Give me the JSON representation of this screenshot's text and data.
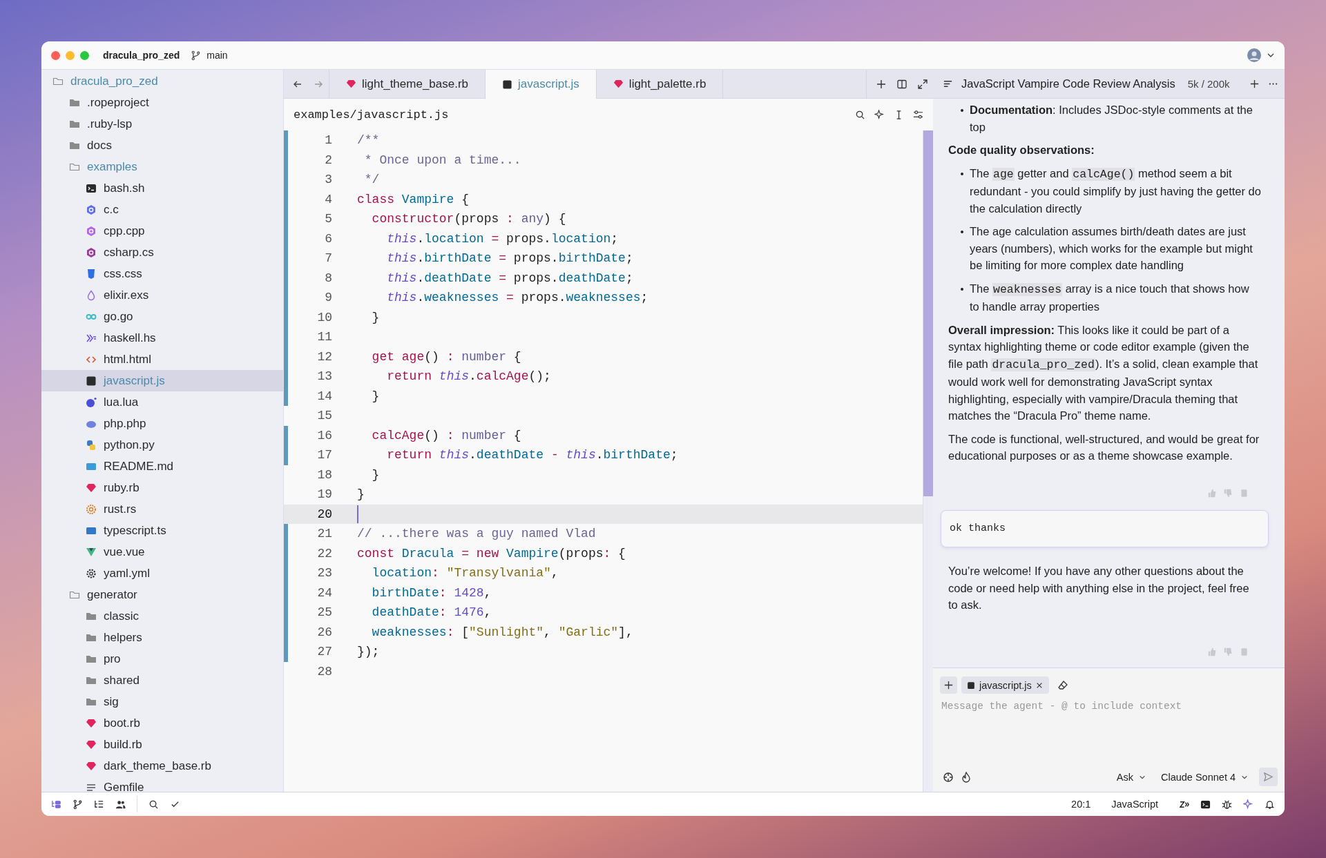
{
  "titlebar": {
    "project": "dracula_pro_zed",
    "branch": "main"
  },
  "sidebar": {
    "items": [
      {
        "name": "dracula_pro_zed",
        "kind": "folder",
        "expanded": true,
        "selected": false,
        "children": [
          {
            "name": ".ropeproject",
            "kind": "folder",
            "expanded": false,
            "selected": false
          },
          {
            "name": ".ruby-lsp",
            "kind": "folder",
            "expanded": false,
            "selected": false
          },
          {
            "name": "docs",
            "kind": "folder",
            "expanded": false,
            "selected": false
          },
          {
            "name": "examples",
            "kind": "folder",
            "expanded": true,
            "selected": false,
            "children": [
              {
                "name": "bash.sh",
                "kind": "shell",
                "selected": false
              },
              {
                "name": "c.c",
                "kind": "c",
                "selected": false
              },
              {
                "name": "cpp.cpp",
                "kind": "cpp",
                "selected": false
              },
              {
                "name": "csharp.cs",
                "kind": "csharp",
                "selected": false
              },
              {
                "name": "css.css",
                "kind": "css",
                "selected": false
              },
              {
                "name": "elixir.exs",
                "kind": "elixir",
                "selected": false
              },
              {
                "name": "go.go",
                "kind": "go",
                "selected": false
              },
              {
                "name": "haskell.hs",
                "kind": "haskell",
                "selected": false
              },
              {
                "name": "html.html",
                "kind": "html",
                "selected": false
              },
              {
                "name": "javascript.js",
                "kind": "js",
                "selected": true
              },
              {
                "name": "lua.lua",
                "kind": "lua",
                "selected": false
              },
              {
                "name": "php.php",
                "kind": "php",
                "selected": false
              },
              {
                "name": "python.py",
                "kind": "python",
                "selected": false
              },
              {
                "name": "README.md",
                "kind": "markdown",
                "selected": false
              },
              {
                "name": "ruby.rb",
                "kind": "ruby",
                "selected": false
              },
              {
                "name": "rust.rs",
                "kind": "rust",
                "selected": false
              },
              {
                "name": "typescript.ts",
                "kind": "ts",
                "selected": false
              },
              {
                "name": "vue.vue",
                "kind": "vue",
                "selected": false
              },
              {
                "name": "yaml.yml",
                "kind": "yaml",
                "selected": false
              }
            ]
          },
          {
            "name": "generator",
            "kind": "folder",
            "expanded": true,
            "selected": false,
            "children": [
              {
                "name": "classic",
                "kind": "folder",
                "expanded": false,
                "selected": false
              },
              {
                "name": "helpers",
                "kind": "folder",
                "expanded": false,
                "selected": false
              },
              {
                "name": "pro",
                "kind": "folder",
                "expanded": false,
                "selected": false
              },
              {
                "name": "shared",
                "kind": "folder",
                "expanded": false,
                "selected": false
              },
              {
                "name": "sig",
                "kind": "folder",
                "expanded": false,
                "selected": false
              },
              {
                "name": "boot.rb",
                "kind": "ruby",
                "selected": false
              },
              {
                "name": "build.rb",
                "kind": "ruby",
                "selected": false
              },
              {
                "name": "dark_theme_base.rb",
                "kind": "ruby",
                "selected": false
              },
              {
                "name": "Gemfile",
                "kind": "text",
                "selected": false
              }
            ]
          }
        ]
      }
    ]
  },
  "tabs": [
    {
      "label": "light_theme_base.rb",
      "kind": "ruby",
      "selected": false
    },
    {
      "label": "javascript.js",
      "kind": "js",
      "selected": true
    },
    {
      "label": "light_palette.rb",
      "kind": "ruby",
      "selected": false
    }
  ],
  "editor": {
    "path": "examples/javascript.js",
    "lines": [
      {
        "number": "1",
        "changed": true,
        "selected": false,
        "tokens": [
          {
            "kind": "cmt",
            "text": "/**"
          }
        ]
      },
      {
        "number": "2",
        "changed": true,
        "selected": false,
        "tokens": [
          {
            "kind": "cmt",
            "text": " * Once upon a time..."
          }
        ]
      },
      {
        "number": "3",
        "changed": true,
        "selected": false,
        "tokens": [
          {
            "kind": "cmt",
            "text": " */"
          }
        ]
      },
      {
        "number": "4",
        "changed": true,
        "selected": false,
        "tokens": [
          {
            "kind": "kw",
            "text": "class "
          },
          {
            "kind": "cls",
            "text": "Vampire"
          },
          {
            "kind": "punc",
            "text": " {"
          }
        ]
      },
      {
        "number": "5",
        "changed": true,
        "selected": false,
        "tokens": [
          {
            "kind": "kw",
            "text": "  constructor"
          },
          {
            "kind": "punc",
            "text": "(props "
          },
          {
            "kind": "op",
            "text": ":"
          },
          {
            "kind": "type",
            "text": " any"
          },
          {
            "kind": "punc",
            "text": ") {"
          }
        ]
      },
      {
        "number": "6",
        "changed": true,
        "selected": false,
        "tokens": [
          {
            "kind": "this",
            "text": "    this"
          },
          {
            "kind": "punc",
            "text": "."
          },
          {
            "kind": "prop",
            "text": "location"
          },
          {
            "kind": "op",
            "text": " = "
          },
          {
            "kind": "punc",
            "text": "props."
          },
          {
            "kind": "prop",
            "text": "location"
          },
          {
            "kind": "punc",
            "text": ";"
          }
        ]
      },
      {
        "number": "7",
        "changed": true,
        "selected": false,
        "tokens": [
          {
            "kind": "this",
            "text": "    this"
          },
          {
            "kind": "punc",
            "text": "."
          },
          {
            "kind": "prop",
            "text": "birthDate"
          },
          {
            "kind": "op",
            "text": " = "
          },
          {
            "kind": "punc",
            "text": "props."
          },
          {
            "kind": "prop",
            "text": "birthDate"
          },
          {
            "kind": "punc",
            "text": ";"
          }
        ]
      },
      {
        "number": "8",
        "changed": true,
        "selected": false,
        "tokens": [
          {
            "kind": "this",
            "text": "    this"
          },
          {
            "kind": "punc",
            "text": "."
          },
          {
            "kind": "prop",
            "text": "deathDate"
          },
          {
            "kind": "op",
            "text": " = "
          },
          {
            "kind": "punc",
            "text": "props."
          },
          {
            "kind": "prop",
            "text": "deathDate"
          },
          {
            "kind": "punc",
            "text": ";"
          }
        ]
      },
      {
        "number": "9",
        "changed": true,
        "selected": false,
        "tokens": [
          {
            "kind": "this",
            "text": "    this"
          },
          {
            "kind": "punc",
            "text": "."
          },
          {
            "kind": "prop",
            "text": "weaknesses"
          },
          {
            "kind": "op",
            "text": " = "
          },
          {
            "kind": "punc",
            "text": "props."
          },
          {
            "kind": "prop",
            "text": "weaknesses"
          },
          {
            "kind": "punc",
            "text": ";"
          }
        ]
      },
      {
        "number": "10",
        "changed": true,
        "selected": false,
        "tokens": [
          {
            "kind": "punc",
            "text": "  }"
          }
        ]
      },
      {
        "number": "11",
        "changed": true,
        "selected": false
      },
      {
        "number": "12",
        "changed": true,
        "selected": false,
        "tokens": [
          {
            "kind": "kw",
            "text": "  get "
          },
          {
            "kind": "kw",
            "text": "age"
          },
          {
            "kind": "punc",
            "text": "() "
          },
          {
            "kind": "op",
            "text": ":"
          },
          {
            "kind": "type",
            "text": " number"
          },
          {
            "kind": "punc",
            "text": " {"
          }
        ]
      },
      {
        "number": "13",
        "changed": true,
        "selected": false,
        "tokens": [
          {
            "kind": "kw",
            "text": "    return "
          },
          {
            "kind": "this",
            "text": "this"
          },
          {
            "kind": "punc",
            "text": "."
          },
          {
            "kind": "kw",
            "text": "calcAge"
          },
          {
            "kind": "punc",
            "text": "();"
          }
        ]
      },
      {
        "number": "14",
        "changed": true,
        "selected": false,
        "tokens": [
          {
            "kind": "punc",
            "text": "  }"
          }
        ]
      },
      {
        "number": "15",
        "changed": false,
        "selected": false
      },
      {
        "number": "16",
        "changed": true,
        "selected": false,
        "tokens": [
          {
            "kind": "kw",
            "text": "  calcAge"
          },
          {
            "kind": "punc",
            "text": "() "
          },
          {
            "kind": "op",
            "text": ":"
          },
          {
            "kind": "type",
            "text": " number"
          },
          {
            "kind": "punc",
            "text": " {"
          }
        ]
      },
      {
        "number": "17",
        "changed": true,
        "selected": false,
        "tokens": [
          {
            "kind": "kw",
            "text": "    return "
          },
          {
            "kind": "this",
            "text": "this"
          },
          {
            "kind": "punc",
            "text": "."
          },
          {
            "kind": "prop",
            "text": "deathDate"
          },
          {
            "kind": "op",
            "text": " - "
          },
          {
            "kind": "this",
            "text": "this"
          },
          {
            "kind": "punc",
            "text": "."
          },
          {
            "kind": "prop",
            "text": "birthDate"
          },
          {
            "kind": "punc",
            "text": ";"
          }
        ]
      },
      {
        "number": "18",
        "changed": false,
        "selected": false,
        "tokens": [
          {
            "kind": "punc",
            "text": "  }"
          }
        ]
      },
      {
        "number": "19",
        "changed": false,
        "selected": false,
        "tokens": [
          {
            "kind": "punc",
            "text": "}"
          }
        ]
      },
      {
        "number": "20",
        "changed": false,
        "selected": true
      },
      {
        "number": "21",
        "changed": true,
        "selected": false,
        "tokens": [
          {
            "kind": "cmt",
            "text": "// ...there was a guy named Vlad"
          }
        ]
      },
      {
        "number": "22",
        "changed": true,
        "selected": false,
        "tokens": [
          {
            "kind": "kw",
            "text": "const "
          },
          {
            "kind": "cls",
            "text": "Dracula"
          },
          {
            "kind": "op",
            "text": " = "
          },
          {
            "kind": "kw",
            "text": "new "
          },
          {
            "kind": "cls",
            "text": "Vampire"
          },
          {
            "kind": "punc",
            "text": "(props"
          },
          {
            "kind": "op",
            "text": ":"
          },
          {
            "kind": "punc",
            "text": " {"
          }
        ]
      },
      {
        "number": "23",
        "changed": true,
        "selected": false,
        "tokens": [
          {
            "kind": "prop",
            "text": "  location"
          },
          {
            "kind": "op",
            "text": ":"
          },
          {
            "kind": "str",
            "text": " \"Transylvania\""
          },
          {
            "kind": "punc",
            "text": ","
          }
        ]
      },
      {
        "number": "24",
        "changed": true,
        "selected": false,
        "tokens": [
          {
            "kind": "prop",
            "text": "  birthDate"
          },
          {
            "kind": "op",
            "text": ":"
          },
          {
            "kind": "num",
            "text": " 1428"
          },
          {
            "kind": "punc",
            "text": ","
          }
        ]
      },
      {
        "number": "25",
        "changed": true,
        "selected": false,
        "tokens": [
          {
            "kind": "prop",
            "text": "  deathDate"
          },
          {
            "kind": "op",
            "text": ":"
          },
          {
            "kind": "num",
            "text": " 1476"
          },
          {
            "kind": "punc",
            "text": ","
          }
        ]
      },
      {
        "number": "26",
        "changed": true,
        "selected": false,
        "tokens": [
          {
            "kind": "prop",
            "text": "  weaknesses"
          },
          {
            "kind": "op",
            "text": ":"
          },
          {
            "kind": "punc",
            "text": " ["
          },
          {
            "kind": "str",
            "text": "\"Sunlight\""
          },
          {
            "kind": "punc",
            "text": ", "
          },
          {
            "kind": "str",
            "text": "\"Garlic\""
          },
          {
            "kind": "punc",
            "text": "],"
          }
        ]
      },
      {
        "number": "27",
        "changed": true,
        "selected": false,
        "tokens": [
          {
            "kind": "punc",
            "text": "});"
          }
        ]
      },
      {
        "number": "28",
        "changed": false,
        "selected": false
      }
    ]
  },
  "assistant": {
    "title": "JavaScript Vampire Code Review Analysis",
    "tokens": "5k / 200k",
    "messages": [
      {
        "kind": "answer",
        "blocks": [
          {
            "kind": "bullet",
            "segments": [
              {
                "kind": "bold",
                "text": "Documentation"
              },
              {
                "kind": "text",
                "text": ": Includes JSDoc-style comments at the top"
              }
            ]
          },
          {
            "kind": "para",
            "segments": [
              {
                "kind": "bold",
                "text": "Code quality observations:"
              }
            ]
          },
          {
            "kind": "bullet",
            "segments": [
              {
                "kind": "text",
                "text": "The "
              },
              {
                "kind": "code",
                "text": "age"
              },
              {
                "kind": "text",
                "text": " getter and "
              },
              {
                "kind": "code",
                "text": "calcAge()"
              },
              {
                "kind": "text",
                "text": " method seem a bit redundant - you could simplify by just having the getter do the calculation directly"
              }
            ]
          },
          {
            "kind": "bullet",
            "segments": [
              {
                "kind": "text",
                "text": "The age calculation assumes birth/death dates are just years (numbers), which works for the example but might be limiting for more complex date handling"
              }
            ]
          },
          {
            "kind": "bullet",
            "segments": [
              {
                "kind": "text",
                "text": "The "
              },
              {
                "kind": "code",
                "text": "weaknesses"
              },
              {
                "kind": "text",
                "text": " array is a nice touch that shows how to handle array properties"
              }
            ]
          },
          {
            "kind": "para",
            "segments": [
              {
                "kind": "bold",
                "text": "Overall impression:"
              },
              {
                "kind": "text",
                "text": " This looks like it could be part of a syntax highlighting theme or code editor example (given the file path "
              },
              {
                "kind": "code",
                "text": "dracula_pro_zed"
              },
              {
                "kind": "text",
                "text": "). It’s a solid, clean example that would work well for demonstrating JavaScript syntax highlighting, especially with vampire/Dracula theming that matches the “Dracula Pro” theme name."
              }
            ]
          },
          {
            "kind": "para",
            "segments": [
              {
                "kind": "text",
                "text": "The code is functional, well-structured, and would be great for educational purposes or as a theme showcase example."
              }
            ]
          }
        ]
      },
      {
        "kind": "prompt",
        "text": "ok thanks"
      },
      {
        "kind": "answer",
        "blocks": [
          {
            "kind": "para",
            "segments": [
              {
                "kind": "text",
                "text": "You’re welcome! If you have any other questions about the code or need help with anything else in the project, feel free to ask."
              }
            ]
          }
        ]
      }
    ],
    "composer": {
      "context": [
        {
          "label": "javascript.js",
          "kind": "js"
        }
      ],
      "placeholder": "Message the agent - @ to include context",
      "mode": "Ask",
      "model": "Claude Sonnet 4"
    }
  },
  "status_bar": {
    "tools": [
      {
        "kind": "tree",
        "selected": true
      },
      {
        "kind": "branch",
        "selected": false
      },
      {
        "kind": "outline",
        "selected": false
      },
      {
        "kind": "people",
        "selected": false
      },
      {
        "kind": "search",
        "selected": false
      },
      {
        "kind": "check",
        "selected": false
      }
    ],
    "position": "20:1",
    "language": "JavaScript"
  }
}
